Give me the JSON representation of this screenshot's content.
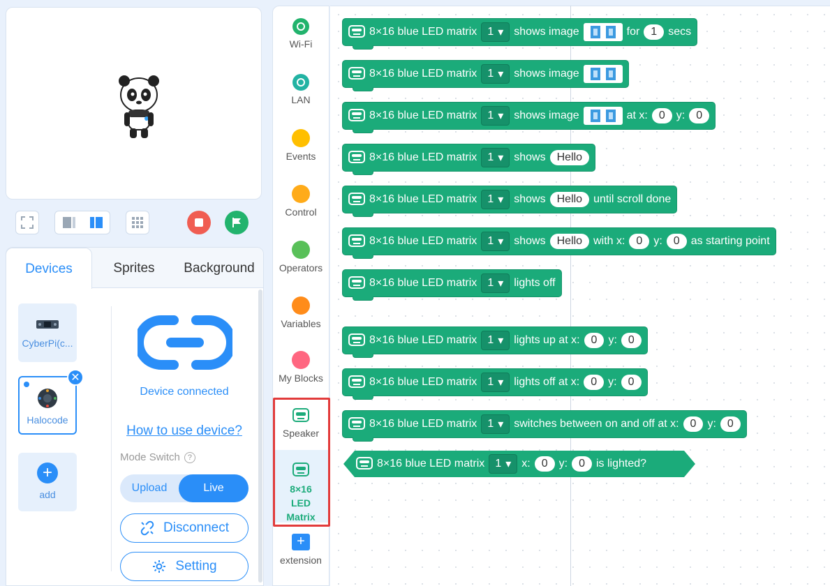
{
  "toolbar": {
    "stop_color": "#f05d52",
    "go_color": "#22b36d"
  },
  "tabs": [
    {
      "label": "Devices",
      "active": true
    },
    {
      "label": "Sprites",
      "active": false
    },
    {
      "label": "Background",
      "active": false
    }
  ],
  "devices": {
    "list": [
      {
        "label": "CyberPi(c...",
        "selected": false
      },
      {
        "label": "Halocode",
        "selected": true
      },
      {
        "label": "add",
        "selected": false
      }
    ],
    "status": "Device connected",
    "help_link": "How to use device?",
    "mode_switch_label": "Mode Switch",
    "mode_upload": "Upload",
    "mode_live": "Live",
    "disconnect": "Disconnect",
    "setting": "Setting"
  },
  "categories": [
    {
      "label": "Wi-Fi",
      "color": "#22b36d",
      "icon": "wifi-icon"
    },
    {
      "label": "LAN",
      "color": "#22b3a3",
      "icon": "lan-icon"
    },
    {
      "label": "Events",
      "color": "#ffbf00"
    },
    {
      "label": "Control",
      "color": "#ffab19"
    },
    {
      "label": "Operators",
      "color": "#59c059"
    },
    {
      "label": "Variables",
      "color": "#ff8c1a"
    },
    {
      "label": "My Blocks",
      "color": "#ff6680"
    },
    {
      "label": "Speaker",
      "color": "#1bab7a",
      "icon": "speaker-icon"
    },
    {
      "label": "8×16 LED Matrix",
      "color": "#1bab7a",
      "icon": "led-matrix-icon",
      "active": true
    },
    {
      "label": "extension",
      "icon": "plus-icon"
    }
  ],
  "blocks": {
    "prefix": "8×16 blue LED matrix",
    "port": "1",
    "b1": {
      "a": "shows image",
      "b": "for",
      "secs_val": "1",
      "c": "secs"
    },
    "b2": {
      "a": "shows image"
    },
    "b3": {
      "a": "shows image",
      "b": "at x:",
      "x": "0",
      "c": "y:",
      "y": "0"
    },
    "b4": {
      "a": "shows",
      "text": "Hello"
    },
    "b5": {
      "a": "shows",
      "text": "Hello",
      "b": "until scroll done"
    },
    "b6": {
      "a": "shows",
      "text": "Hello",
      "b": "with x:",
      "x": "0",
      "c": "y:",
      "y": "0",
      "d": "as starting point"
    },
    "b7": {
      "a": "lights off"
    },
    "b8": {
      "a": "lights up at x:",
      "x": "0",
      "b": "y:",
      "y": "0"
    },
    "b9": {
      "a": "lights off at x:",
      "x": "0",
      "b": "y:",
      "y": "0"
    },
    "b10": {
      "a": "switches between on and off at x:",
      "x": "0",
      "b": "y:",
      "y": "0"
    },
    "b11": {
      "a": "x:",
      "x": "0",
      "b": "y:",
      "y": "0",
      "c": "is lighted?"
    }
  }
}
